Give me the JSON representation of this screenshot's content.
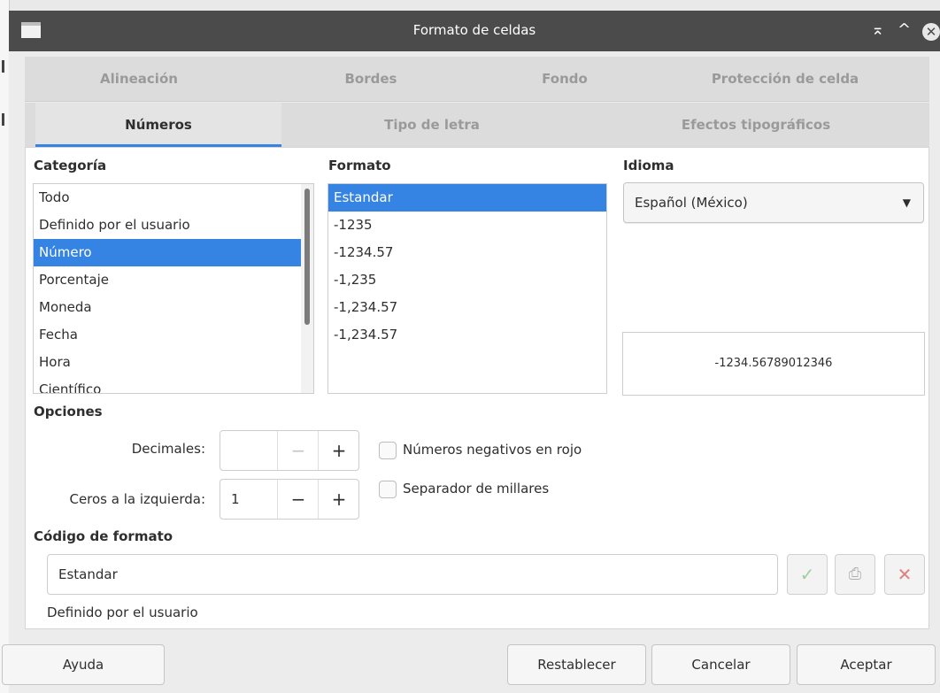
{
  "window": {
    "title": "Formato de celdas",
    "icons": {
      "app": "window-icon",
      "shade": "shade-icon",
      "maximize": "maximize-icon",
      "close": "close-icon"
    },
    "controls": {
      "shade": "⌅",
      "maximize": "^",
      "close": "✕"
    }
  },
  "tabs": {
    "row1": [
      "Alineación",
      "Bordes",
      "Fondo",
      "Protección de celda"
    ],
    "row2": [
      "Números",
      "Tipo de letra",
      "Efectos tipográficos"
    ],
    "active": "Números"
  },
  "category": {
    "label": "Categoría",
    "items": [
      "Todo",
      "Definido por el usuario",
      "Número",
      "Porcentaje",
      "Moneda",
      "Fecha",
      "Hora",
      "Científico"
    ],
    "selected": "Número"
  },
  "format": {
    "label": "Formato",
    "items": [
      "Estandar",
      "-1235",
      "-1234.57",
      "-1,235",
      "-1,234.57",
      "-1,234.57"
    ],
    "selected": "Estandar"
  },
  "language": {
    "label": "Idioma",
    "value": "Español (México)",
    "caret": "▼",
    "preview": "-1234.56789012346"
  },
  "options": {
    "label": "Opciones",
    "decimals_label": "Decimales:",
    "decimals_value": "",
    "leading_zeros_label": "Ceros a la izquierda:",
    "leading_zeros_value": "1",
    "minus": "−",
    "plus": "+",
    "negative_red_label": "Números negativos en rojo",
    "negative_red_checked": false,
    "thousands_sep_label": "Separador de millares",
    "thousands_sep_checked": false
  },
  "format_code": {
    "label": "Código de formato",
    "value": "Estandar",
    "description": "Definido por el usuario",
    "icons": {
      "add": "checkmark-icon",
      "edit_comment": "comment-icon",
      "delete": "delete-x-icon"
    },
    "glyphs": {
      "add": "✓",
      "edit_comment": "⎙",
      "delete": "✕"
    }
  },
  "buttons": {
    "help": "Ayuda",
    "reset": "Restablecer",
    "cancel": "Cancelar",
    "ok": "Aceptar"
  },
  "colors": {
    "accent": "#3584e4",
    "titlebar": "#4b4b4b",
    "delete_icon": "#e07f7f",
    "check_icon": "#9fcf9f"
  }
}
